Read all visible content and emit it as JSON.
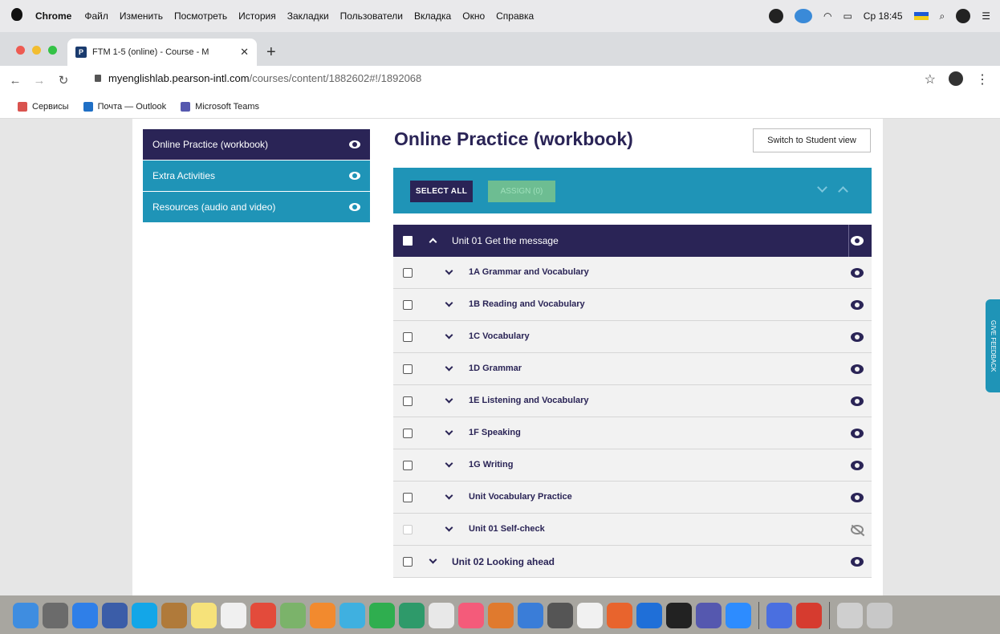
{
  "menubar": {
    "app": "Chrome",
    "items": [
      "Файл",
      "Изменить",
      "Посмотреть",
      "История",
      "Закладки",
      "Пользователи",
      "Вкладка",
      "Окно",
      "Справка"
    ],
    "clock": "Ср 18:45"
  },
  "tab": {
    "favicon": "P",
    "title": "FTM 1-5 (online) - Course - M",
    "close": "✕",
    "newtab": "+"
  },
  "address": {
    "host": "myenglishlab.pearson-intl.com",
    "path": "/courses/content/1882602#!/1892068"
  },
  "bookmarks": [
    {
      "label": "Сервисы",
      "color": "#d9534f"
    },
    {
      "label": "Почта — Outlook",
      "color": "#1f6fc5"
    },
    {
      "label": "Microsoft Teams",
      "color": "#5558af"
    }
  ],
  "sidebar": {
    "items": [
      {
        "label": "Online Practice (workbook)"
      },
      {
        "label": "Extra Activities"
      },
      {
        "label": "Resources (audio and video)"
      }
    ]
  },
  "main": {
    "title": "Online Practice (workbook)",
    "switch_label": "Switch to Student view",
    "select_all": "SELECT ALL",
    "assign": "ASSIGN (0)"
  },
  "unit1": {
    "label": "Unit 01 Get the message"
  },
  "lessons": [
    {
      "label": "1A Grammar and Vocabulary",
      "hidden": false
    },
    {
      "label": "1B Reading and Vocabulary",
      "hidden": false
    },
    {
      "label": "1C Vocabulary",
      "hidden": false
    },
    {
      "label": "1D Grammar",
      "hidden": false
    },
    {
      "label": "1E Listening and Vocabulary",
      "hidden": false
    },
    {
      "label": "1F Speaking",
      "hidden": false
    },
    {
      "label": "1G Writing",
      "hidden": false
    },
    {
      "label": "Unit Vocabulary Practice",
      "hidden": false
    },
    {
      "label": "Unit 01 Self-check",
      "hidden": true
    }
  ],
  "unit2": {
    "label": "Unit 02 Looking ahead"
  },
  "feedback_label": "GIVE FEEDBACK",
  "dock_colors": [
    "#3f8de0",
    "#6b6b6b",
    "#2f7fe8",
    "#3b5da8",
    "#13a6e8",
    "#b07a3a",
    "#f6e27a",
    "#f0f0f0",
    "#e34b3b",
    "#7bb36a",
    "#f28a2e",
    "#3fb0e0",
    "#2fae4f",
    "#2e9a6a",
    "#e8e8e8",
    "#f45b7a",
    "#e07a2e",
    "#3a7dd8",
    "#555555",
    "#f1f1f1",
    "#e8642d",
    "#1f6fd8",
    "#222222",
    "#5558af",
    "#2d8cff",
    "#4a6fe0",
    "#d63b2f",
    "#cfcfcf",
    "#c8c8c8"
  ]
}
